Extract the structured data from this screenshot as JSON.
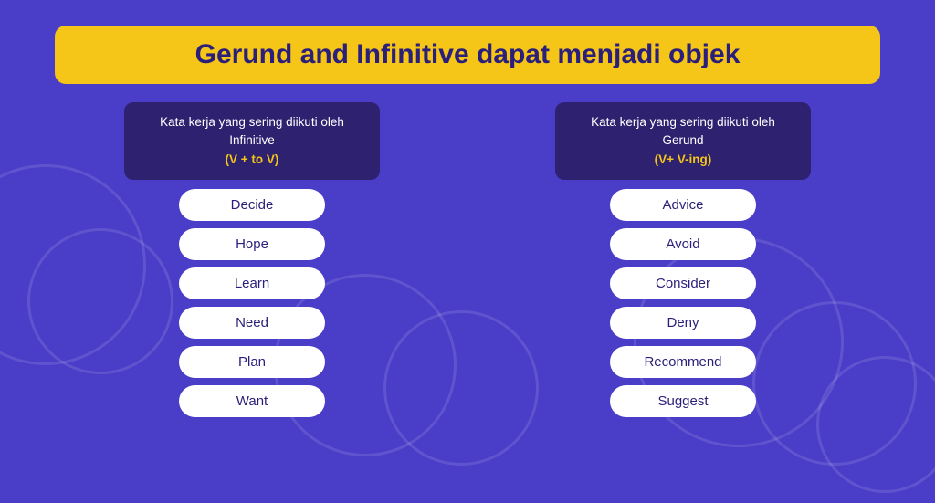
{
  "page": {
    "background_color": "#4a3dc8",
    "title": "Gerund and Infinitive dapat menjadi objek"
  },
  "left_column": {
    "header_line1": "Kata kerja yang sering diikuti oleh Infinitive",
    "header_highlight": "(V + to V)",
    "words": [
      "Decide",
      "Hope",
      "Learn",
      "Need",
      "Plan",
      "Want"
    ]
  },
  "right_column": {
    "header_line1": "Kata kerja yang sering diikuti oleh Gerund",
    "header_highlight": "(V+ V-ing)",
    "words": [
      "Advice",
      "Avoid",
      "Consider",
      "Deny",
      "Recommend",
      "Suggest"
    ]
  }
}
